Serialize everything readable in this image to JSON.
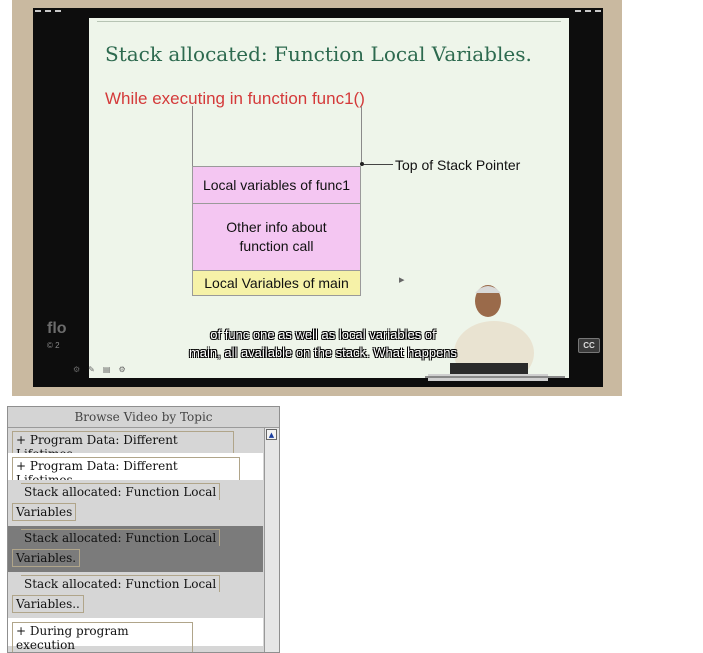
{
  "video": {
    "slide": {
      "title": "Stack allocated: Function Local Variables.",
      "subtitle": "While executing in function func1()",
      "box_func1": "Local variables of func1",
      "box_other_line1": "Other info about",
      "box_other_line2": "function call",
      "box_main": "Local Variables of main",
      "top_of_stack_label": "Top of Stack Pointer"
    },
    "logo_text": "flo",
    "copyright_text": "© 2",
    "caption_line1": "of func one as well as local variables of",
    "caption_line2": "main, all available on the stack. What happens",
    "cc_label": "CC",
    "colors": {
      "slide_title": "#2d6a4f",
      "slide_subtitle": "#d43a3a",
      "box_pink": "#f4c6f2",
      "box_yellow": "#f6f2a8"
    }
  },
  "browse": {
    "title": "Browse Video by Topic",
    "items": [
      {
        "text": "+ Program Data: Different Lifetimes."
      },
      {
        "text": "+ Program Data: Different Lifetimes.."
      },
      {
        "line1": "Stack allocated: Function Local",
        "line2": "Variables"
      },
      {
        "line1": "Stack allocated: Function Local",
        "line2": "Variables."
      },
      {
        "line1": "Stack allocated: Function Local",
        "line2": "Variables.."
      },
      {
        "text": "+ During program execution"
      }
    ],
    "selected_index": 3
  }
}
